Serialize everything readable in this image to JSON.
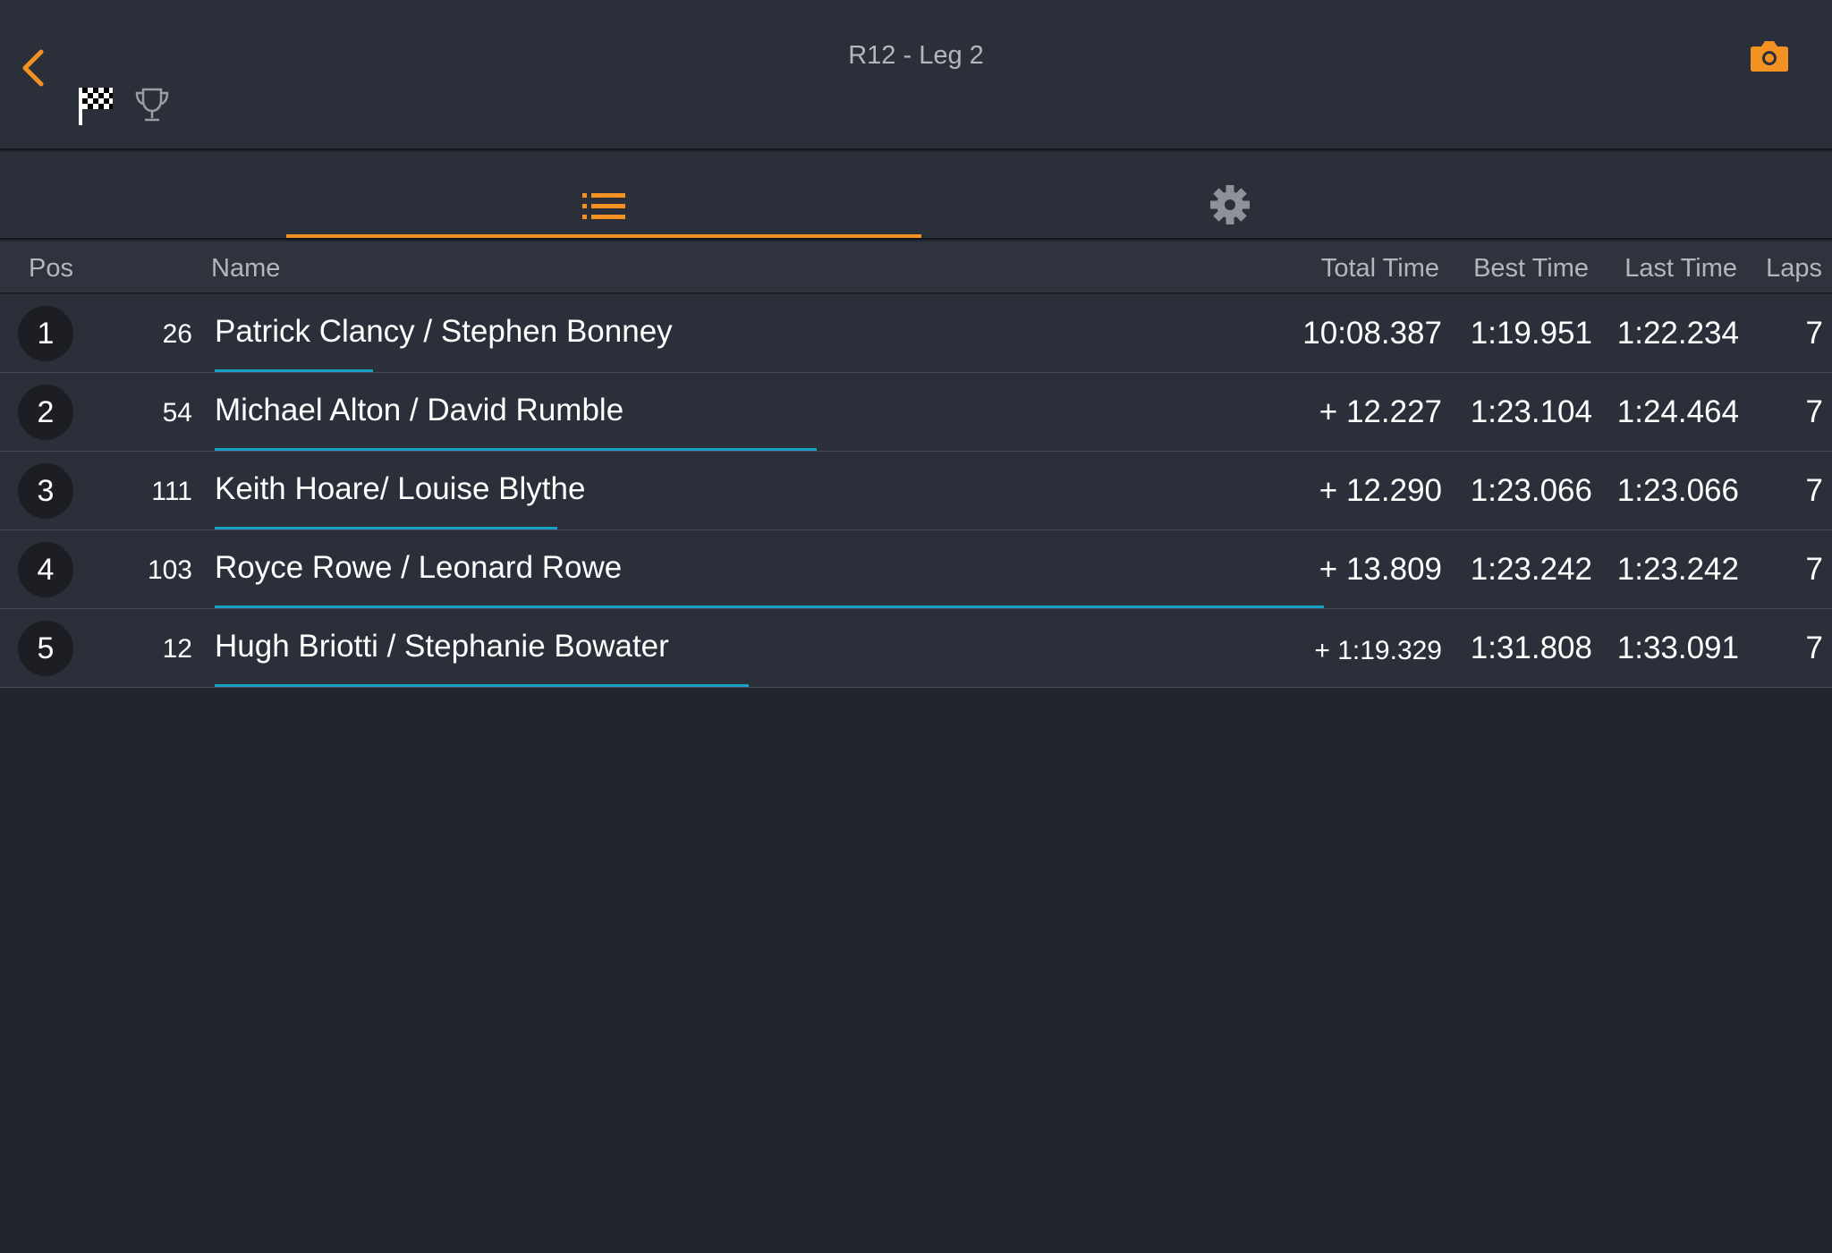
{
  "header": {
    "title": "R12 - Leg 2",
    "back_icon": "chevron-left-icon",
    "flag_icon": "checkered-flag-icon",
    "trophy_icon": "trophy-icon",
    "camera_icon": "camera-icon",
    "accent_color": "#f39221"
  },
  "tabs": [
    {
      "icon": "list-icon",
      "active": true
    },
    {
      "icon": "gear-icon",
      "active": false
    }
  ],
  "table": {
    "columns": {
      "pos": "Pos",
      "name": "Name",
      "total": "Total Time",
      "best": "Best Time",
      "last": "Last Time",
      "laps": "Laps"
    },
    "rows": [
      {
        "pos": "1",
        "car": "26",
        "name": "Patrick Clancy /  Stephen Bonney",
        "total": "10:08.387",
        "best": "1:19.951",
        "last": "1:22.234",
        "laps": "7",
        "progress": 0.098
      },
      {
        "pos": "2",
        "car": "54",
        "name": "Michael Alton /  David Rumble",
        "total": "+ 12.227",
        "best": "1:23.104",
        "last": "1:24.464",
        "laps": "7",
        "progress": 0.372
      },
      {
        "pos": "3",
        "car": "111",
        "name": "Keith Hoare/ Louise Blythe",
        "total": "+ 12.290",
        "best": "1:23.066",
        "last": "1:23.066",
        "laps": "7",
        "progress": 0.212
      },
      {
        "pos": "4",
        "car": "103",
        "name": "Royce Rowe /  Leonard Rowe",
        "total": "+ 13.809",
        "best": "1:23.242",
        "last": "1:23.242",
        "laps": "7",
        "progress": 0.686
      },
      {
        "pos": "5",
        "car": "12",
        "name": "Hugh Briotti /  Stephanie Bowater",
        "total": "+ 1:19.329",
        "best": "1:31.808",
        "last": "1:33.091",
        "laps": "7",
        "progress": 0.33
      }
    ]
  }
}
